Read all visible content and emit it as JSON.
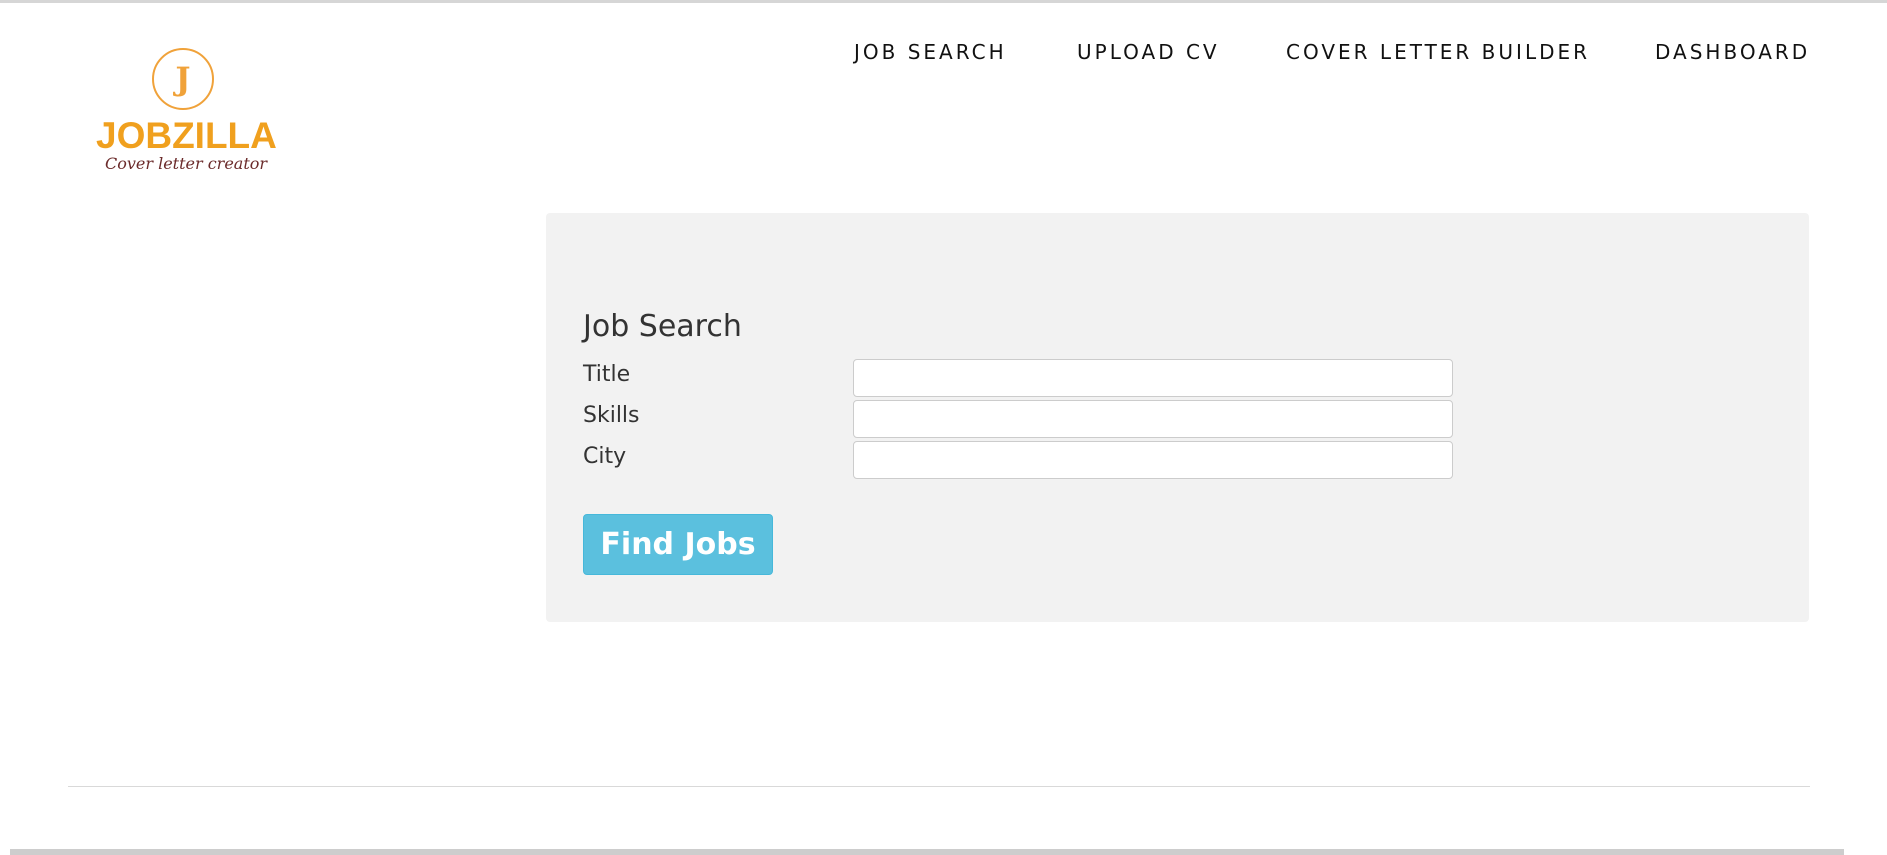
{
  "brand": {
    "logo_letter": "J",
    "name": "JOBZILLA",
    "tagline": "Cover letter creator",
    "colors": {
      "primary": "#f0a01e",
      "tagline": "#6b2b2b"
    }
  },
  "nav": {
    "items": [
      {
        "label": "JOB SEARCH"
      },
      {
        "label": "UPLOAD CV"
      },
      {
        "label": "COVER LETTER BUILDER"
      },
      {
        "label": "DASHBOARD"
      }
    ]
  },
  "search": {
    "title": "Job Search",
    "fields": {
      "title": {
        "label": "Title",
        "value": "",
        "placeholder": ""
      },
      "skills": {
        "label": "Skills",
        "value": "",
        "placeholder": ""
      },
      "city": {
        "label": "City",
        "value": "",
        "placeholder": ""
      }
    },
    "submit_label": "Find Jobs",
    "colors": {
      "panel_bg": "#f2f2f2",
      "button_bg": "#5bc0de"
    }
  }
}
